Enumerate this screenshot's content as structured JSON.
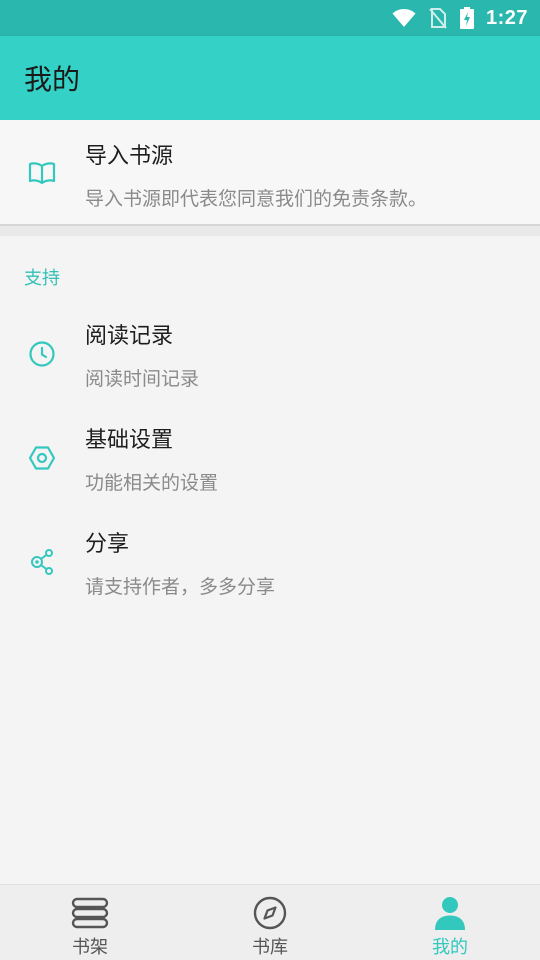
{
  "status_bar": {
    "time": "1:27"
  },
  "app_bar": {
    "title": "我的"
  },
  "import_source": {
    "title": "导入书源",
    "subtitle": "导入书源即代表您同意我们的免责条款。",
    "icon": "book-open-icon"
  },
  "support_section": {
    "header": "支持",
    "items": [
      {
        "title": "阅读记录",
        "subtitle": "阅读时间记录",
        "icon": "clock-icon"
      },
      {
        "title": "基础设置",
        "subtitle": "功能相关的设置",
        "icon": "settings-hexagon-icon"
      },
      {
        "title": "分享",
        "subtitle": "请支持作者，多多分享",
        "icon": "share-icon"
      }
    ]
  },
  "bottom_nav": {
    "items": [
      {
        "label": "书架",
        "icon": "bookshelf-icon",
        "active": false
      },
      {
        "label": "书库",
        "icon": "compass-icon",
        "active": false
      },
      {
        "label": "我的",
        "icon": "person-icon",
        "active": true
      }
    ]
  },
  "colors": {
    "accent": "#33d1c6",
    "status_bar": "#2ab7ad",
    "icon_tint": "#33c8be",
    "background": "#f4f4f4"
  }
}
